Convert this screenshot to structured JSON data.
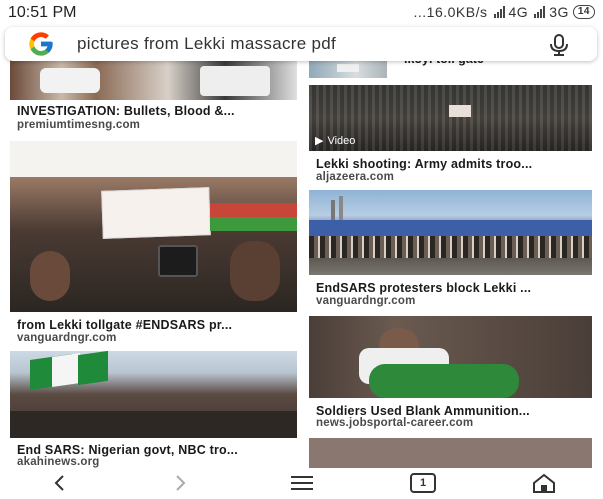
{
  "status_bar": {
    "time": "10:51 PM",
    "network_speed": "...16.0KB/s",
    "network_1": "4G",
    "network_2": "3G",
    "battery": "14"
  },
  "search": {
    "query": "pictures from Lekki massacre pdf",
    "google_logo": "google-g-logo",
    "mic_icon": "mic-icon"
  },
  "results": {
    "left": [
      {
        "title": "INVESTIGATION: Bullets, Blood &...",
        "source": "premiumtimesng.com"
      },
      {
        "title": "from Lekki tollgate #ENDSARS pr...",
        "source": "vanguardngr.com"
      },
      {
        "title": "End SARS: Nigerian govt, NBC tro...",
        "source": "akahinews.org"
      }
    ],
    "right": [
      {
        "partial_title": "Ikoyi toll gate"
      },
      {
        "title": "Lekki shooting: Army admits troo...",
        "source": "aljazeera.com",
        "badge": "Video"
      },
      {
        "title": "EndSARS protesters block Lekki ...",
        "source": "vanguardngr.com"
      },
      {
        "title": "Soldiers Used Blank Ammunition...",
        "source": "news.jobsportal-career.com"
      }
    ]
  },
  "nav": {
    "back_icon": "chevron-left-icon",
    "forward_icon": "chevron-right-icon",
    "menu_icon": "hamburger-menu-icon",
    "tabs_count": "1",
    "home_icon": "home-icon"
  },
  "colors": {
    "caption_text": "#1a1a1a",
    "source_text": "#4a4a4a",
    "search_text": "#333333"
  }
}
